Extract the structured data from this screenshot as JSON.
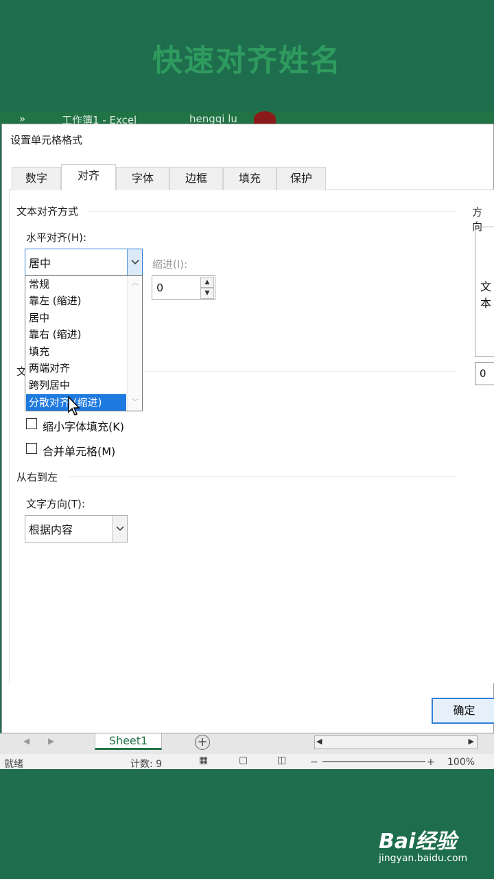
{
  "banner": {
    "title": "快速对齐姓名"
  },
  "excel": {
    "titlebar": {
      "doc": "工作簿1 - Excel",
      "user": "hengqi lu",
      "chevrons": "»"
    },
    "sheet_tab": "Sheet1",
    "add_sheet": "⊕",
    "status": {
      "ready": "就绪",
      "count": "计数: 9",
      "zoom": "100%"
    }
  },
  "dialog": {
    "title": "设置单元格格式",
    "tabs": [
      "数字",
      "对齐",
      "字体",
      "边框",
      "填充",
      "保护"
    ],
    "active_tab": "对齐",
    "text_alignment": {
      "section": "文本对齐方式",
      "horizontal_label": "水平对齐(H):",
      "horizontal_value": "居中",
      "indent_label": "缩进(I):",
      "indent_value": "0",
      "options": [
        "常规",
        "靠左 (缩进)",
        "居中",
        "靠右 (缩进)",
        "填充",
        "两端对齐",
        "跨列居中",
        "分散对齐 (缩进)"
      ],
      "selected_option": "分散对齐 (缩进)"
    },
    "text_control": {
      "section_partial": "文",
      "shrink_label": "缩小字体填充(K)",
      "merge_label": "合并单元格(M)"
    },
    "rtl": {
      "section": "从右到左",
      "direction_label": "文字方向(T):",
      "direction_value": "根据内容"
    },
    "orientation": {
      "section": "方向",
      "text1": "文",
      "text2": "本",
      "degrees": "0"
    },
    "ok_button": "确定"
  },
  "watermark": {
    "brand": "Bai经验",
    "url": "jingyan.baidu.com"
  }
}
